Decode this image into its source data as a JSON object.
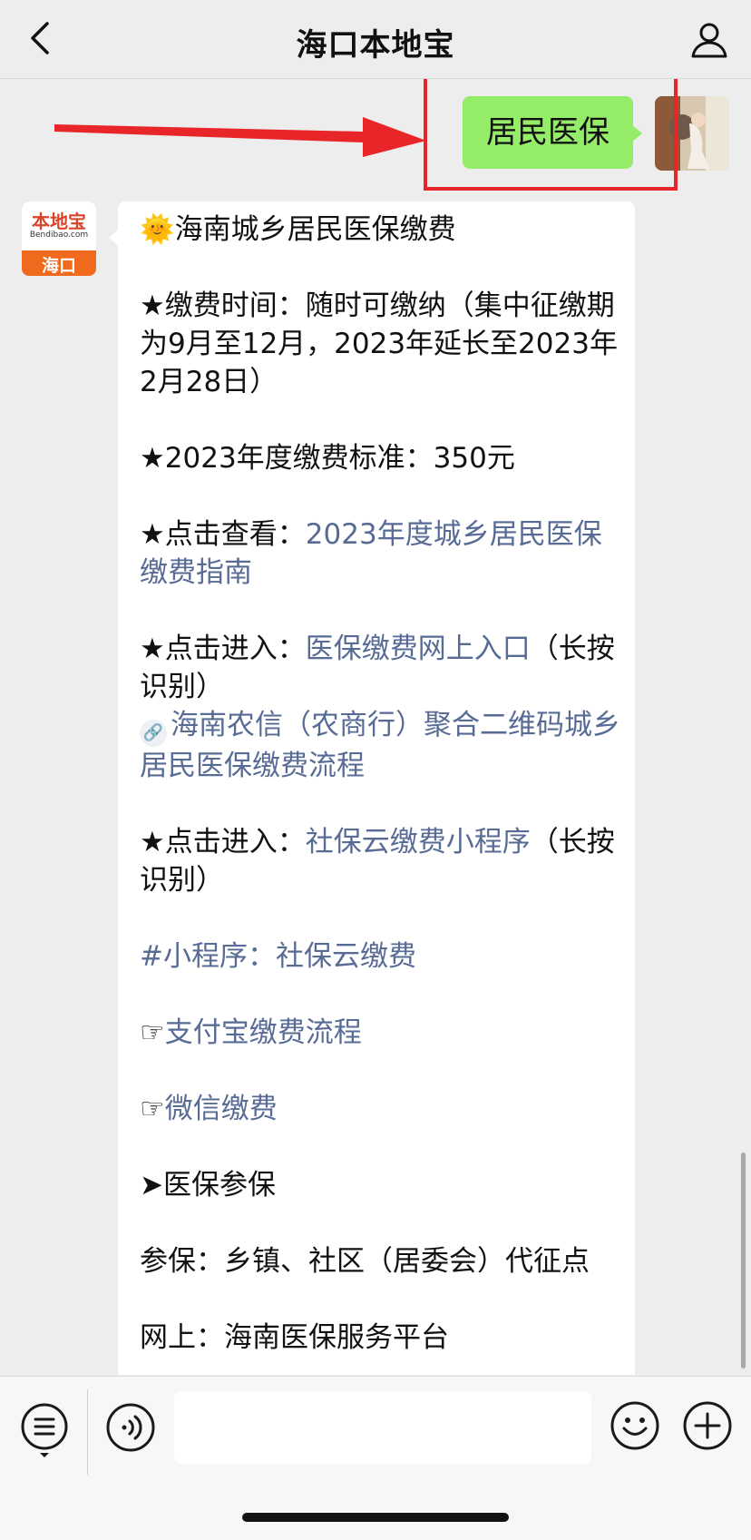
{
  "navbar": {
    "title": "海口本地宝",
    "back_icon": "chevron-left-icon",
    "profile_icon": "person-icon"
  },
  "outgoing": {
    "text": "居民医保"
  },
  "incoming": {
    "avatar": {
      "brand": "本地宝",
      "brand_sub": "Bendibao.com",
      "city": "海口"
    },
    "title": "海南城乡居民医保缴费",
    "items": {
      "pay_time": "★缴费时间：随时可缴纳（集中征缴期为9月至12月，2023年延长至2023年2月28日）",
      "standard": "★2023年度缴费标准：350元",
      "guide_prefix": "★点击查看：",
      "guide_link": "2023年度城乡居民医保缴费指南",
      "online_prefix": "★点击进入：",
      "online_link": "医保缴费网上入口",
      "online_suffix": "（长按识别）",
      "nongxin_link": "海南农信（农商行）聚合二维码城乡居民医保缴费流程",
      "miniapp_prefix": "★点击进入：",
      "miniapp_link": "社保云缴费小程序",
      "miniapp_suffix": "（长按识别）",
      "miniapp_tag": "#小程序：社保云缴费",
      "alipay_link": "支付宝缴费流程",
      "wechat_link": "微信缴费",
      "section": "➤医保参保",
      "enroll": "参保：乡镇、社区（居委会）代征点",
      "partial": "网上：海南医保服务平台"
    }
  },
  "bottombar": {
    "input_value": "",
    "icons": [
      "menu-list-icon",
      "voice-icon",
      "emoji-icon",
      "plus-icon"
    ]
  },
  "colors": {
    "accent_green": "#95ec69",
    "link": "#576b95",
    "highlight_red": "#e8262a"
  }
}
